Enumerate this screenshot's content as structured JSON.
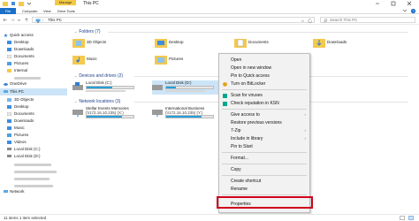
{
  "window": {
    "title": "This PC",
    "contextual_tab": "Manage"
  },
  "ribbon": {
    "tabs": [
      "File",
      "Computer",
      "View",
      "Drive Tools"
    ]
  },
  "address_bar": {
    "path": "This PC",
    "search_placeholder": "Search This PC"
  },
  "nav": {
    "quick_access": "Quick access",
    "items": [
      {
        "label": "Desktop",
        "icon": "folder-desktop-icon"
      },
      {
        "label": "Downloads",
        "icon": "folder-download-icon"
      },
      {
        "label": "Documents",
        "icon": "folder-documents-icon"
      },
      {
        "label": "Pictures",
        "icon": "folder-pictures-icon"
      },
      {
        "label": "Internal",
        "icon": "folder-icon"
      }
    ],
    "onedrive": "OneDrive",
    "this_pc": "This PC",
    "pc_items": [
      {
        "label": "3D Objects",
        "icon": "folder-3d-icon"
      },
      {
        "label": "Desktop",
        "icon": "folder-desktop-icon"
      },
      {
        "label": "Documents",
        "icon": "folder-documents-icon"
      },
      {
        "label": "Downloads",
        "icon": "folder-download-icon"
      },
      {
        "label": "Music",
        "icon": "folder-music-icon"
      },
      {
        "label": "Pictures",
        "icon": "folder-pictures-icon"
      },
      {
        "label": "Videos",
        "icon": "folder-videos-icon"
      },
      {
        "label": "Local Disk (C:)",
        "icon": "drive-icon"
      },
      {
        "label": "Local Disk (D:)",
        "icon": "drive-icon"
      }
    ],
    "network": "Network"
  },
  "content": {
    "folders_header": "Folders (7)",
    "folders": [
      {
        "label": "3D Objects"
      },
      {
        "label": "Desktop"
      },
      {
        "label": "Documents"
      },
      {
        "label": "Downloads"
      },
      {
        "label": "Music"
      },
      {
        "label": "Pictures"
      }
    ],
    "devices_header": "Devices and drives (2)",
    "drives": [
      {
        "label": "Local Disk (C:)",
        "used_fraction": 0.55
      },
      {
        "label": "Local Disk (D:)",
        "used_fraction": 0.2
      }
    ],
    "network_header": "Network locations (3)",
    "network_locations": [
      {
        "name": "Stellar Events Memories",
        "address": "(\\\\172.16.10.235) (X:)",
        "used_fraction": 0.75
      },
      {
        "name": "International Business",
        "address": "(\\\\172.16.10.235) (Y:)",
        "used_fraction": 0.75
      }
    ]
  },
  "context_menu": {
    "items": [
      {
        "label": "Open"
      },
      {
        "label": "Open in new window"
      },
      {
        "label": "Pin to Quick access"
      },
      {
        "label": "Turn on BitLocker",
        "icon": "shield-icon"
      },
      {
        "label": "Scan for viruses",
        "icon": "scan-icon"
      },
      {
        "label": "Check reputation in KSN",
        "icon": "ksn-icon"
      },
      {
        "label": "Give access to",
        "submenu": true
      },
      {
        "label": "Restore previous versions"
      },
      {
        "label": "7-Zip",
        "submenu": true
      },
      {
        "label": "Include in library",
        "submenu": true
      },
      {
        "label": "Pin to Start"
      },
      {
        "label": "Format..."
      },
      {
        "label": "Copy"
      },
      {
        "label": "Create shortcut"
      },
      {
        "label": "Rename"
      },
      {
        "label": "Properties"
      }
    ]
  },
  "status": {
    "text": "11 items   1 item selected"
  },
  "colors": {
    "accent": "#1a6fc9",
    "selection": "#cce4f7",
    "drive_bar": "#26a0da",
    "highlight_box": "#d0021b",
    "manage_tab": "#f4c842"
  }
}
